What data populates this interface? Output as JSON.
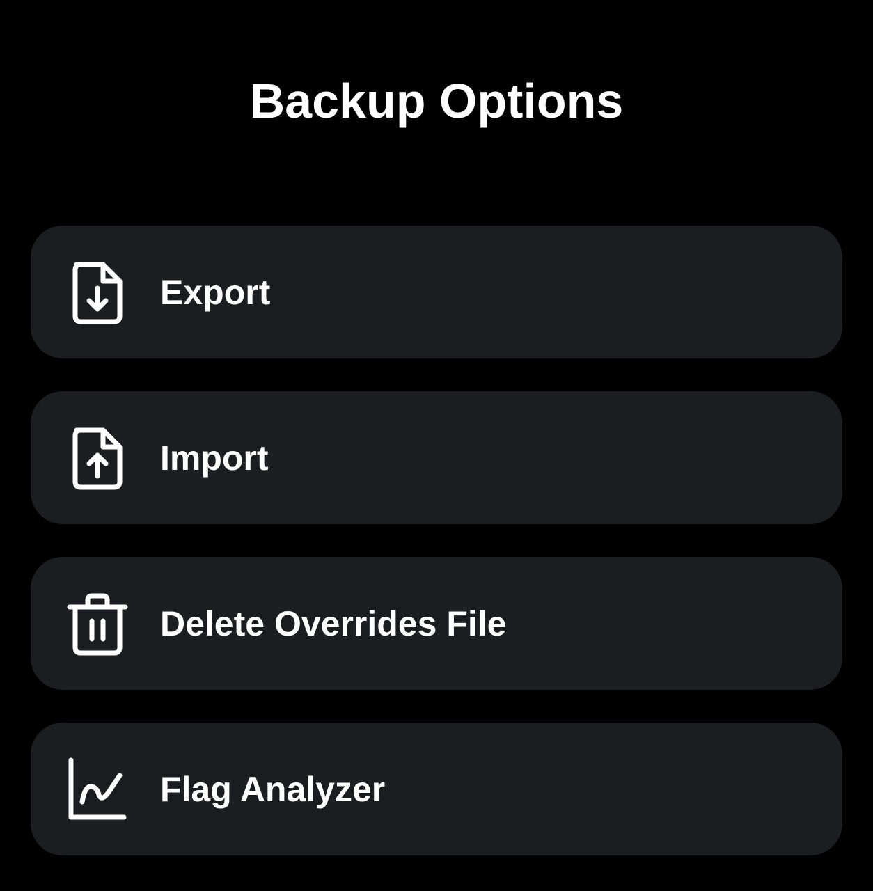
{
  "header": {
    "title": "Backup Options"
  },
  "theme": {
    "background": "#000000",
    "card": "#1c1d21",
    "text": "#ffffff"
  },
  "options": [
    {
      "icon": "file-download-icon",
      "label": "Export"
    },
    {
      "icon": "file-upload-icon",
      "label": "Import"
    },
    {
      "icon": "trash-icon",
      "label": "Delete Overrides File"
    },
    {
      "icon": "line-chart-icon",
      "label": "Flag Analyzer"
    }
  ]
}
